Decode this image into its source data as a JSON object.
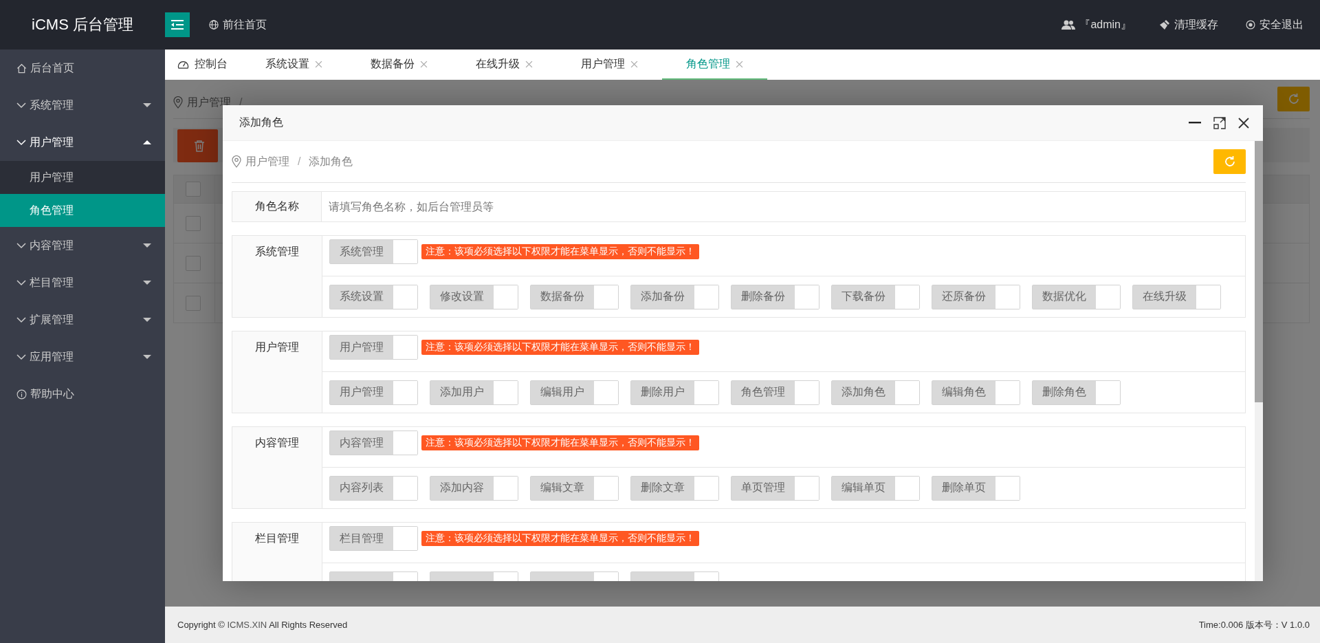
{
  "header": {
    "logo": "iCMS 后台管理",
    "home_link": "前往首页",
    "user": "『admin』",
    "clear_cache": "清理缓存",
    "logout": "安全退出"
  },
  "sidebar": {
    "items": [
      {
        "label": "后台首页",
        "kind": "home"
      },
      {
        "label": "系统管理",
        "kind": "group",
        "expanded": false
      },
      {
        "label": "用户管理",
        "kind": "group",
        "expanded": true,
        "children": [
          {
            "label": "用户管理",
            "selected": false
          },
          {
            "label": "角色管理",
            "selected": true
          }
        ]
      },
      {
        "label": "内容管理",
        "kind": "group",
        "expanded": false
      },
      {
        "label": "栏目管理",
        "kind": "group",
        "expanded": false
      },
      {
        "label": "扩展管理",
        "kind": "group",
        "expanded": false
      },
      {
        "label": "应用管理",
        "kind": "group",
        "expanded": false
      },
      {
        "label": "帮助中心",
        "kind": "help"
      }
    ]
  },
  "tabs": [
    {
      "label": "控制台",
      "kind": "home",
      "selected": false
    },
    {
      "label": "系统设置",
      "kind": "closable",
      "selected": false
    },
    {
      "label": "数据备份",
      "kind": "closable",
      "selected": false
    },
    {
      "label": "在线升级",
      "kind": "closable",
      "selected": false
    },
    {
      "label": "用户管理",
      "kind": "closable",
      "selected": false
    },
    {
      "label": "角色管理",
      "kind": "closable",
      "selected": true
    }
  ],
  "background_page": {
    "breadcrumb": {
      "items": [
        "用户管理"
      ],
      "separator": "/"
    },
    "table": {
      "header_checked": false,
      "rows": [
        {
          "checked": false
        },
        {
          "checked": false
        },
        {
          "checked": false
        }
      ]
    }
  },
  "dialog": {
    "title": "添加角色",
    "breadcrumb": {
      "items": [
        "用户管理",
        "添加角色"
      ],
      "separator": "/"
    },
    "name_field": {
      "label": "角色名称",
      "placeholder": "请填写角色名称，如后台管理员等"
    },
    "sections": [
      {
        "title": "系统管理",
        "main": {
          "label": "系统管理",
          "on": false
        },
        "note": "注意：该项必须选择以下权限才能在菜单显示，否则不能显示！",
        "permissions": [
          {
            "label": "系统设置",
            "on": false
          },
          {
            "label": "修改设置",
            "on": false
          },
          {
            "label": "数据备份",
            "on": false
          },
          {
            "label": "添加备份",
            "on": false
          },
          {
            "label": "删除备份",
            "on": false
          },
          {
            "label": "下载备份",
            "on": false
          },
          {
            "label": "还原备份",
            "on": false
          },
          {
            "label": "数据优化",
            "on": false
          },
          {
            "label": "在线升级",
            "on": false
          }
        ]
      },
      {
        "title": "用户管理",
        "main": {
          "label": "用户管理",
          "on": false
        },
        "note": "注意：该项必须选择以下权限才能在菜单显示，否则不能显示！",
        "permissions": [
          {
            "label": "用户管理",
            "on": false
          },
          {
            "label": "添加用户",
            "on": false
          },
          {
            "label": "编辑用户",
            "on": false
          },
          {
            "label": "删除用户",
            "on": false
          },
          {
            "label": "角色管理",
            "on": false
          },
          {
            "label": "添加角色",
            "on": false
          },
          {
            "label": "编辑角色",
            "on": false
          },
          {
            "label": "删除角色",
            "on": false
          }
        ]
      },
      {
        "title": "内容管理",
        "main": {
          "label": "内容管理",
          "on": false
        },
        "note": "注意：该项必须选择以下权限才能在菜单显示，否则不能显示！",
        "permissions": [
          {
            "label": "内容列表",
            "on": false
          },
          {
            "label": "添加内容",
            "on": false
          },
          {
            "label": "编辑文章",
            "on": false
          },
          {
            "label": "删除文章",
            "on": false
          },
          {
            "label": "单页管理",
            "on": false
          },
          {
            "label": "编辑单页",
            "on": false
          },
          {
            "label": "删除单页",
            "on": false
          }
        ]
      },
      {
        "title": "栏目管理",
        "main": {
          "label": "栏目管理",
          "on": false
        },
        "note": "注意：该项必须选择以下权限才能在菜单显示，否则不能显示！",
        "permissions": [
          {
            "on": false
          },
          {
            "on": false
          },
          {
            "on": false
          },
          {
            "on": false
          }
        ]
      }
    ]
  },
  "footer": {
    "copyright": {
      "prefix": "Copyright © ",
      "link": "ICMS.XIN",
      "suffix": " All Rights Reserved"
    },
    "info": "Time:0.006 版本号：V 1.0.0"
  }
}
